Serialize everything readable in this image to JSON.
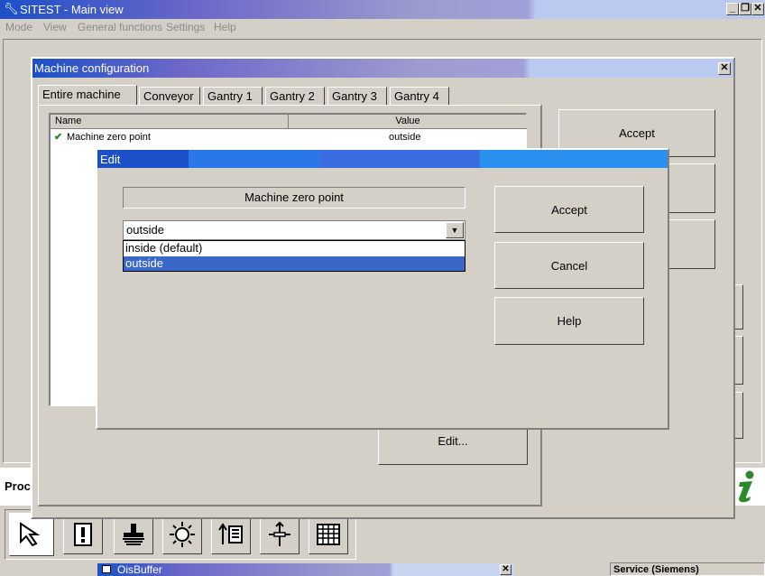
{
  "main_window": {
    "title": "SITEST - Main view",
    "menu": [
      "Mode",
      "View",
      "General functions",
      "Settings",
      "Help"
    ],
    "status_left": "Proc",
    "status_right": "Service (Siemens)"
  },
  "taskbar": {
    "title": "OisBuffer"
  },
  "machine_config": {
    "title": "Machine configuration",
    "tabs": [
      "Entire machine",
      "Conveyor",
      "Gantry 1",
      "Gantry 2",
      "Gantry 3",
      "Gantry 4"
    ],
    "columns": [
      "Name",
      "Value"
    ],
    "rows": [
      {
        "name": "Machine zero point",
        "value": "outside"
      }
    ],
    "accept_label": "Accept",
    "edit_label": "Edit..."
  },
  "edit_dialog": {
    "title": "Edit",
    "field_label": "Machine zero point",
    "selected_value": "outside",
    "options": [
      "inside (default)",
      "outside"
    ],
    "accept_label": "Accept",
    "cancel_label": "Cancel",
    "help_label": "Help"
  },
  "icons": [
    "wrench-icon",
    "checkmark-icon",
    "pointer-icon",
    "exclamation-icon",
    "stamp-icon",
    "sun-icon",
    "transfer-icon",
    "align-icon",
    "matrix-icon",
    "info-icon"
  ],
  "colors": {
    "selection": "#3a68c8",
    "check_green": "#1f8a1f",
    "info_green": "#2a8a2a"
  }
}
